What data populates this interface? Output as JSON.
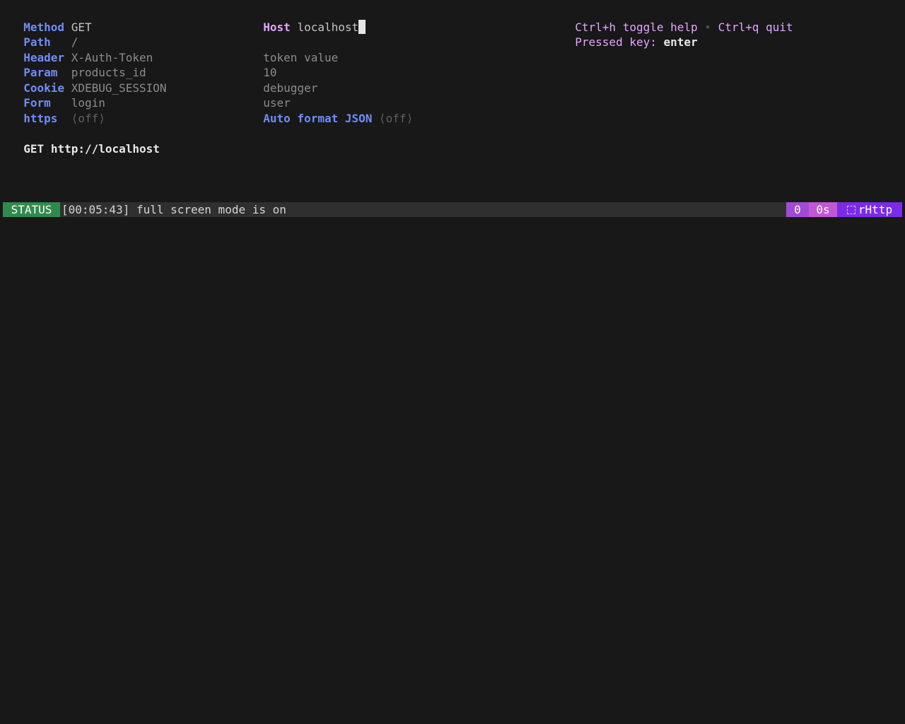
{
  "request": {
    "method_label": "Method",
    "method_value": "GET",
    "path_label": "Path",
    "path_value": "/",
    "header_label": "Header",
    "header_key": "X-Auth-Token",
    "header_value": "token value",
    "param_label": "Param",
    "param_key": "products_id",
    "param_value": "10",
    "cookie_label": "Cookie",
    "cookie_key": "XDEBUG_SESSION",
    "cookie_value": "debugger",
    "form_label": "Form",
    "form_key": "login",
    "form_value": "user",
    "https_label": "https",
    "https_state": "⟨off⟩",
    "host_label": "Host",
    "host_value": "localhost",
    "auto_format_label": "Auto format JSON",
    "auto_format_state": "⟨off⟩"
  },
  "help": {
    "toggle_help": "Ctrl+h toggle help",
    "separator": "•",
    "quit": "Ctrl+q quit",
    "pressed_key_label": "Pressed key:",
    "pressed_key_value": "enter"
  },
  "url_line": {
    "method": "GET",
    "url": "http://localhost"
  },
  "status_bar": {
    "tag": "STATUS",
    "message": "[00:05:43] full screen mode is on",
    "count": "0",
    "time": "0s",
    "app_name": "rHttp",
    "app_icon": "dashed-box-icon"
  },
  "colors": {
    "background": "#181818",
    "label_blue": "#6f8df5",
    "label_pink": "#e3a6ff",
    "status_green": "#2e8b4c",
    "badge_purple": "#a24ad8",
    "badge_magenta": "#c256d6",
    "badge_violet": "#7b2be8"
  }
}
